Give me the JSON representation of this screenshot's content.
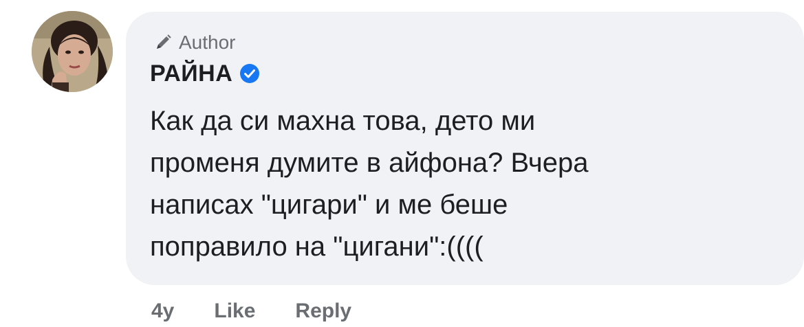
{
  "comment": {
    "author_badge": "Author",
    "author_name": "РАЙНА",
    "text_lines": [
      "Как да си махна това, дето ми",
      "променя думите в айфона? Вчера",
      "написах \"цигари\" и ме беше",
      "поправило на \"цигани\":(((("
    ],
    "timestamp": "4y",
    "like_label": "Like",
    "reply_label": "Reply"
  },
  "icons": {
    "badge": "pencil-icon",
    "verified": "verified-check-icon",
    "avatar": "profile-avatar"
  },
  "colors": {
    "bubble_background": "#f0f2f5",
    "verified_blue": "#1877f2",
    "secondary_text": "#6a6d72",
    "primary_text": "#1c1e21"
  }
}
